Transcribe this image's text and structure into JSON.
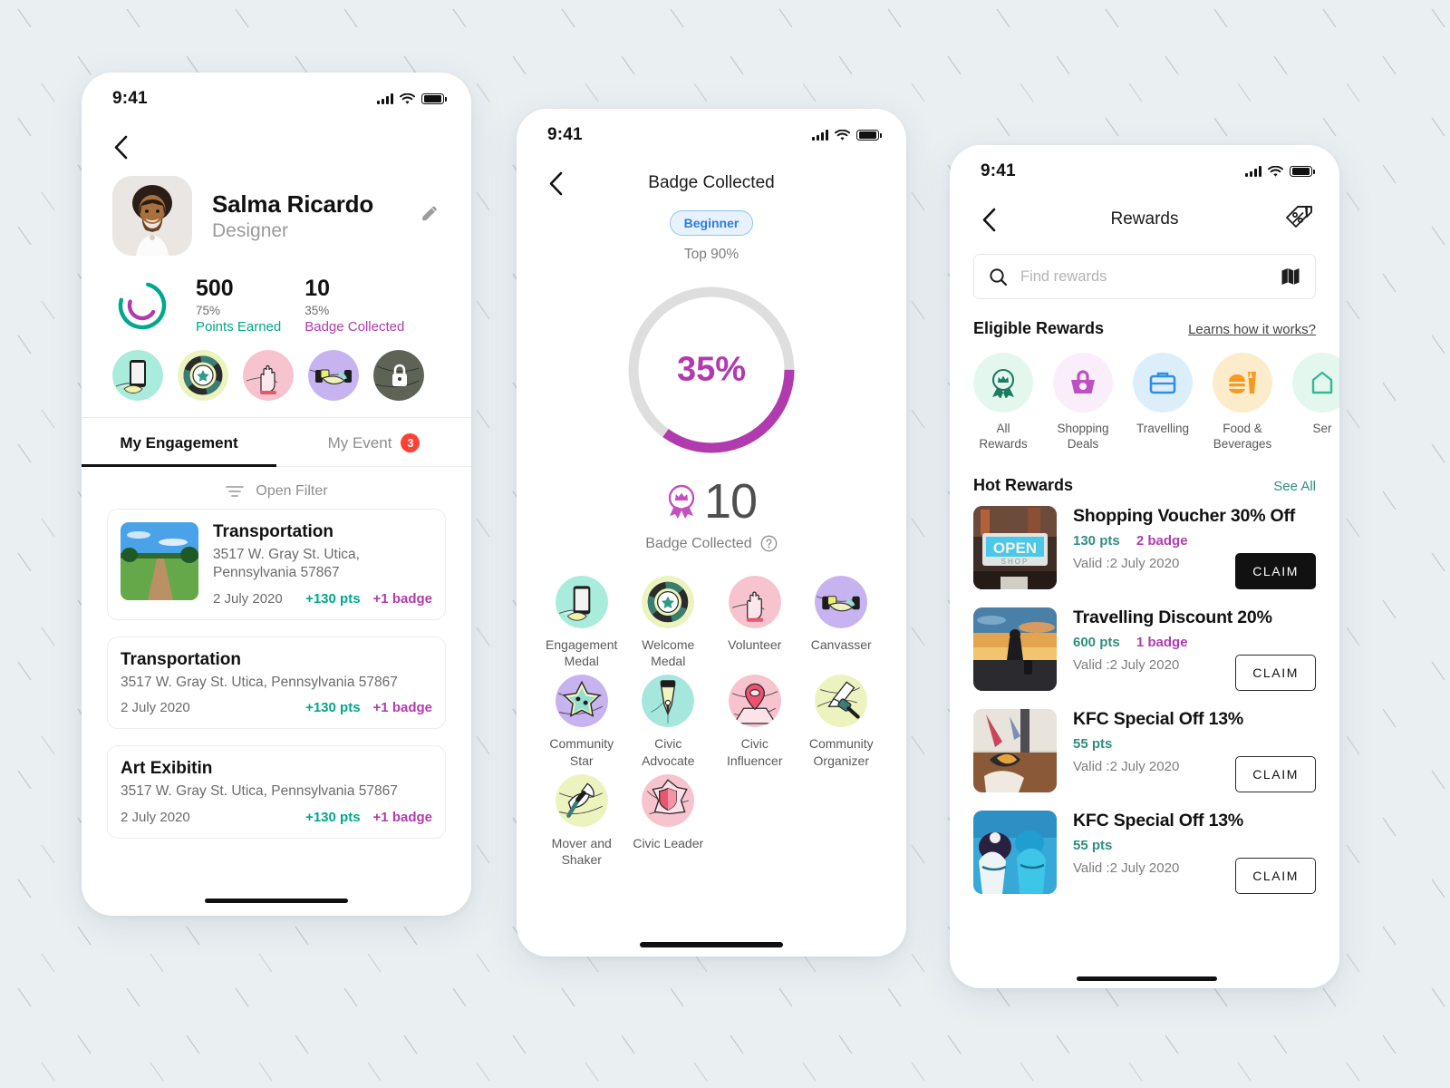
{
  "theme": {
    "teal": "#00a88e",
    "purple": "#b13bae",
    "dark": "#111111",
    "badge_red": "#ff4133",
    "blue": "#2b7de0",
    "background": "#eaeff2"
  },
  "phone1": {
    "status": {
      "time": "9:41"
    },
    "profile": {
      "name": "Salma Ricardo",
      "role": "Designer"
    },
    "stats": [
      {
        "value": "500",
        "percent": "75%",
        "label": "Points Earned",
        "color": "#00a88e"
      },
      {
        "value": "10",
        "percent": "35%",
        "label": "Badge Collected",
        "color": "#b13bae"
      }
    ],
    "tabs": [
      {
        "label": "My Engagement",
        "active": true,
        "badge": ""
      },
      {
        "label": "My Event",
        "active": false,
        "badge": "3"
      }
    ],
    "filter_label": "Open Filter",
    "engagements": [
      {
        "title": "Transportation",
        "address": "3517 W. Gray St. Utica, Pennsylvania 57867",
        "date": "2 July 2020",
        "points": "+130 pts",
        "badge": "+1 badge",
        "has_thumb": true
      },
      {
        "title": "Transportation",
        "address": "3517 W. Gray St. Utica, Pennsylvania 57867",
        "date": "2 July 2020",
        "points": "+130 pts",
        "badge": "+1 badge",
        "has_thumb": false
      },
      {
        "title": "Art Exibitin",
        "address": "3517 W. Gray St. Utica, Pennsylvania 57867",
        "date": "2 July 2020",
        "points": "+130 pts",
        "badge": "+1 badge",
        "has_thumb": false
      }
    ]
  },
  "phone2": {
    "status": {
      "time": "9:41"
    },
    "nav_title": "Badge Collected",
    "level": "Beginner",
    "top_percent": "Top 90%",
    "progress_label": "35%",
    "progress_value": 35,
    "count": "10",
    "count_caption": "Badge Collected",
    "badges": [
      {
        "label": "Engagement Medal"
      },
      {
        "label": "Welcome Medal"
      },
      {
        "label": "Volunteer"
      },
      {
        "label": "Canvasser"
      },
      {
        "label": "Community Star"
      },
      {
        "label": "Civic Advocate"
      },
      {
        "label": "Civic Influencer"
      },
      {
        "label": "Community Organizer"
      },
      {
        "label": "Mover and Shaker"
      },
      {
        "label": "Civic Leader"
      }
    ]
  },
  "phone3": {
    "status": {
      "time": "9:41"
    },
    "nav_title": "Rewards",
    "search": {
      "placeholder": "Find rewards",
      "value": ""
    },
    "eligible": {
      "title": "Eligible Rewards",
      "link": "Learns how it works?"
    },
    "categories": [
      {
        "label": "All Rewards"
      },
      {
        "label": "Shopping Deals"
      },
      {
        "label": "Travelling"
      },
      {
        "label": "Food & Beverages"
      },
      {
        "label": "Ser"
      }
    ],
    "hot": {
      "title": "Hot Rewards",
      "link": "See All"
    },
    "rewards": [
      {
        "title": "Shopping Voucher 30% Off",
        "points": "130 pts",
        "badge": "2 badge",
        "valid": "Valid :2 July 2020",
        "claim": "CLAIM",
        "claim_style": "solid"
      },
      {
        "title": "Travelling Discount 20%",
        "points": "600 pts",
        "badge": "1 badge",
        "valid": "Valid :2 July 2020",
        "claim": "CLAIM",
        "claim_style": "ghost"
      },
      {
        "title": "KFC Special Off 13%",
        "points": "55 pts",
        "badge": "",
        "valid": "Valid :2 July 2020",
        "claim": "CLAIM",
        "claim_style": "ghost"
      },
      {
        "title": "KFC Special Off 13%",
        "points": "55 pts",
        "badge": "",
        "valid": "Valid :2 July 2020",
        "claim": "CLAIM",
        "claim_style": "ghost"
      }
    ]
  }
}
